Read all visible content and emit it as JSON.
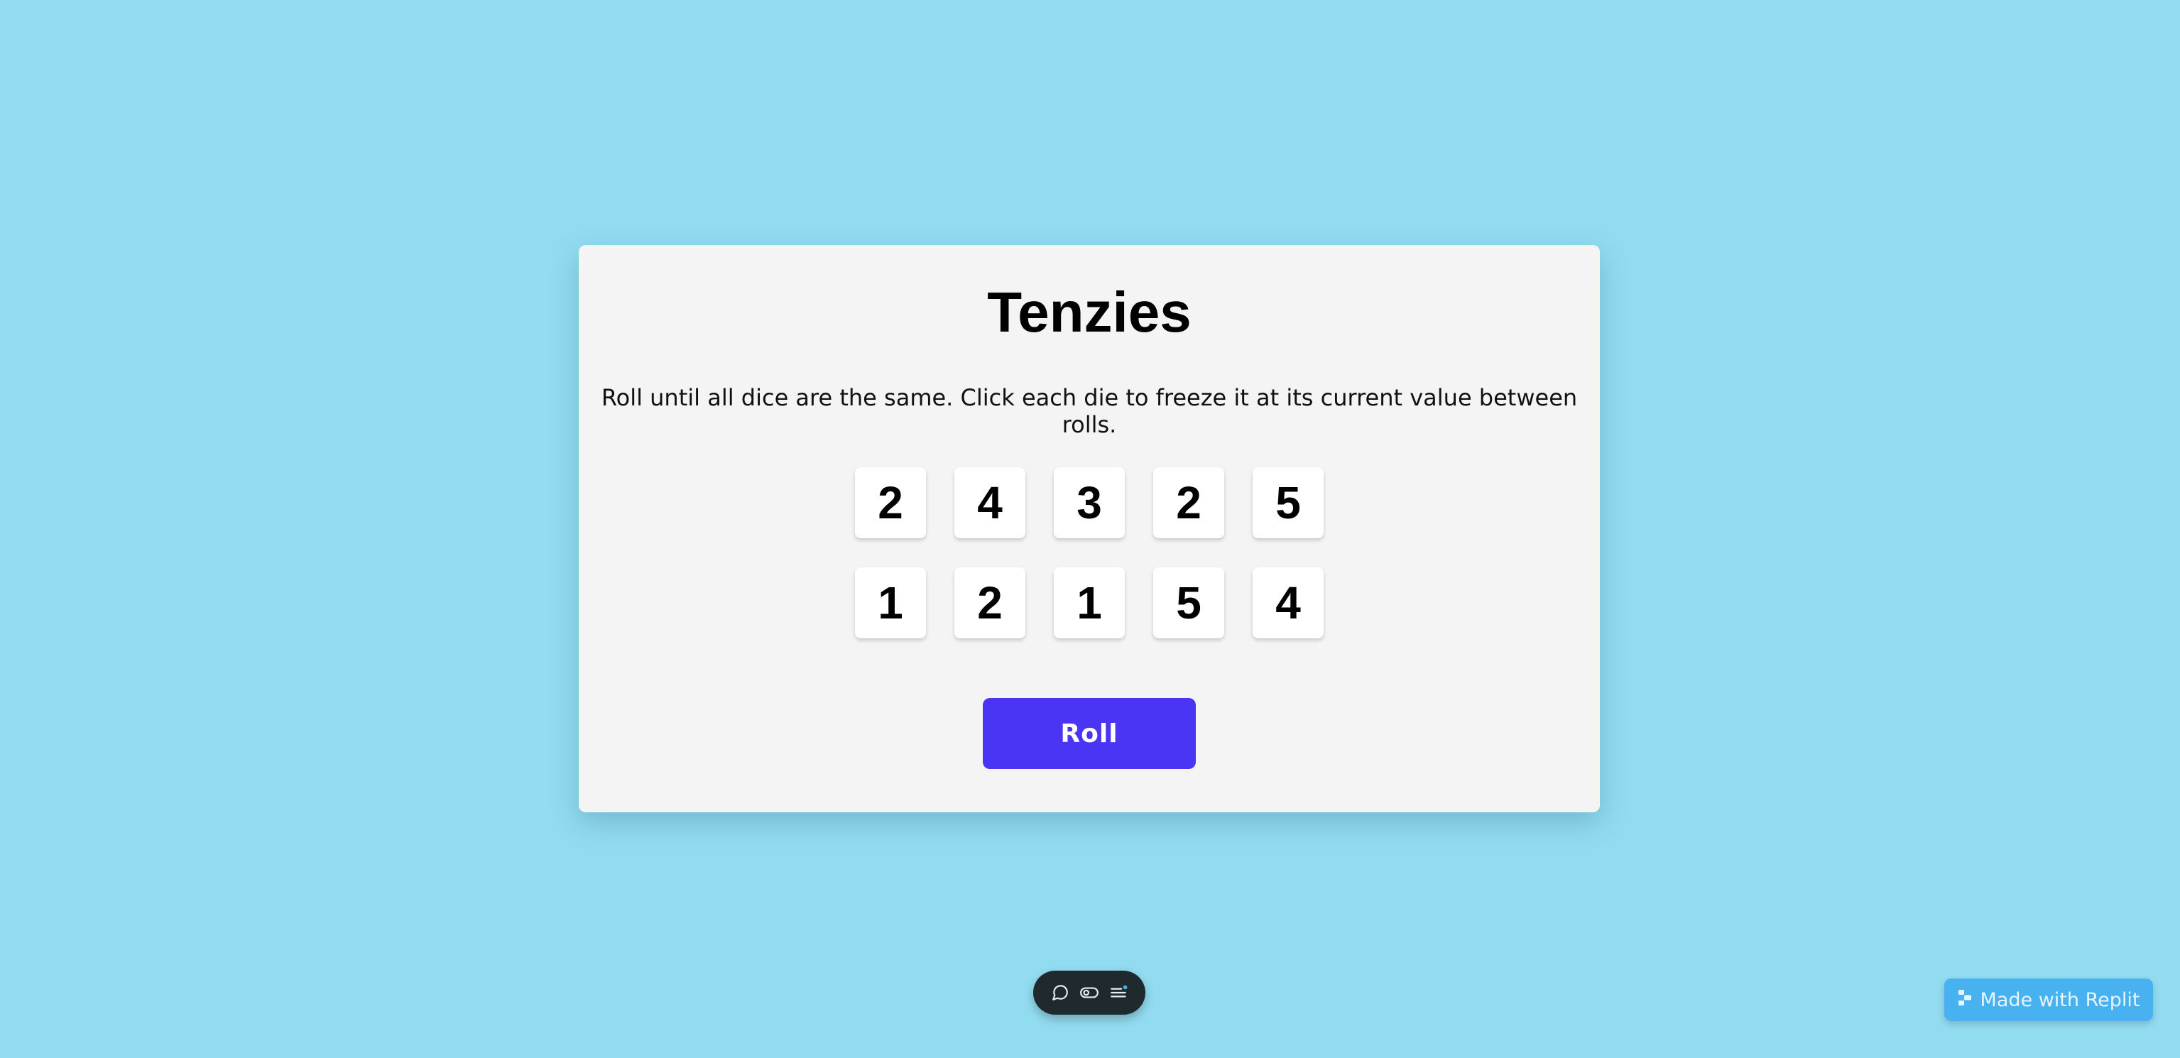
{
  "app": {
    "title": "Tenzies",
    "instructions": "Roll until all dice are the same. Click each die to freeze it at its current value between rolls."
  },
  "dice": [
    {
      "value": "2"
    },
    {
      "value": "4"
    },
    {
      "value": "3"
    },
    {
      "value": "2"
    },
    {
      "value": "5"
    },
    {
      "value": "1"
    },
    {
      "value": "2"
    },
    {
      "value": "1"
    },
    {
      "value": "5"
    },
    {
      "value": "4"
    }
  ],
  "roll_button": {
    "label": "Roll"
  },
  "toolbar": {
    "icons": [
      "chat-icon",
      "toggle-icon",
      "menu-list-icon"
    ]
  },
  "badge": {
    "label": "Made with Replit",
    "icon": "replit-logo-icon"
  },
  "colors": {
    "background": "#92dcf1",
    "card": "#f4f4f4",
    "roll_button": "#4a35f5",
    "badge": "#47b2ef",
    "toolbar": "#1f2a2f"
  }
}
